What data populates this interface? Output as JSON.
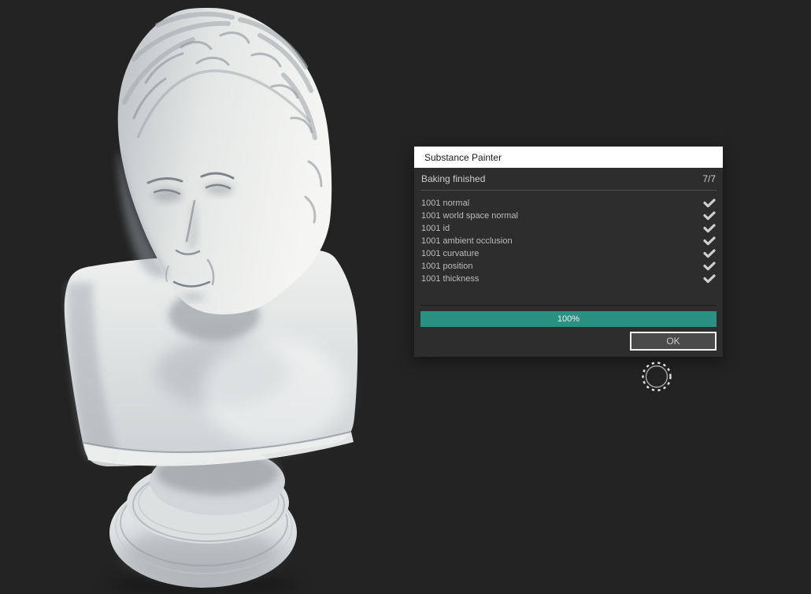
{
  "viewport": {
    "model_name": "plaster-bust-sculpture"
  },
  "dialog": {
    "title": "Substance Painter",
    "status_label": "Baking finished",
    "progress_count": "7/7",
    "items": [
      {
        "label": "1001 normal",
        "status_icon": "checkmark-icon"
      },
      {
        "label": "1001 world space normal",
        "status_icon": "checkmark-icon"
      },
      {
        "label": "1001 id",
        "status_icon": "checkmark-icon"
      },
      {
        "label": "1001 ambient occlusion",
        "status_icon": "checkmark-icon"
      },
      {
        "label": "1001 curvature",
        "status_icon": "checkmark-icon"
      },
      {
        "label": "1001 position",
        "status_icon": "checkmark-icon"
      },
      {
        "label": "1001 thickness",
        "status_icon": "checkmark-icon"
      }
    ],
    "progress_percent": "100%",
    "ok_label": "OK",
    "accent_color": "#2b9082",
    "check_color": "#cfcfcf"
  },
  "cursor": {
    "icon": "brush-cursor-icon"
  }
}
